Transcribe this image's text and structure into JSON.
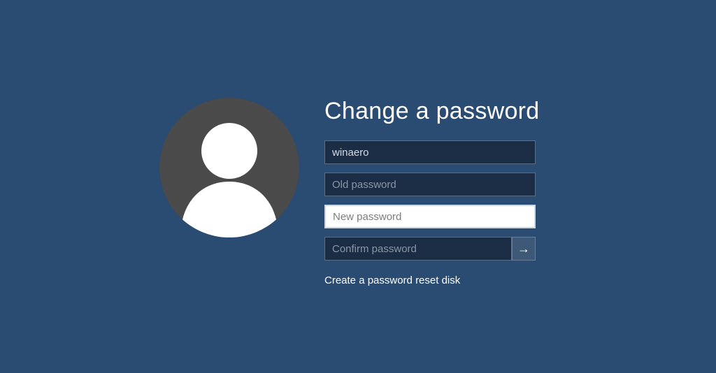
{
  "heading": "Change a password",
  "username": {
    "value": "winaero"
  },
  "old_password": {
    "placeholder": "Old password"
  },
  "new_password": {
    "placeholder": "New password"
  },
  "confirm_password": {
    "placeholder": "Confirm password"
  },
  "submit_arrow": "→",
  "reset_link": "Create a password reset disk"
}
